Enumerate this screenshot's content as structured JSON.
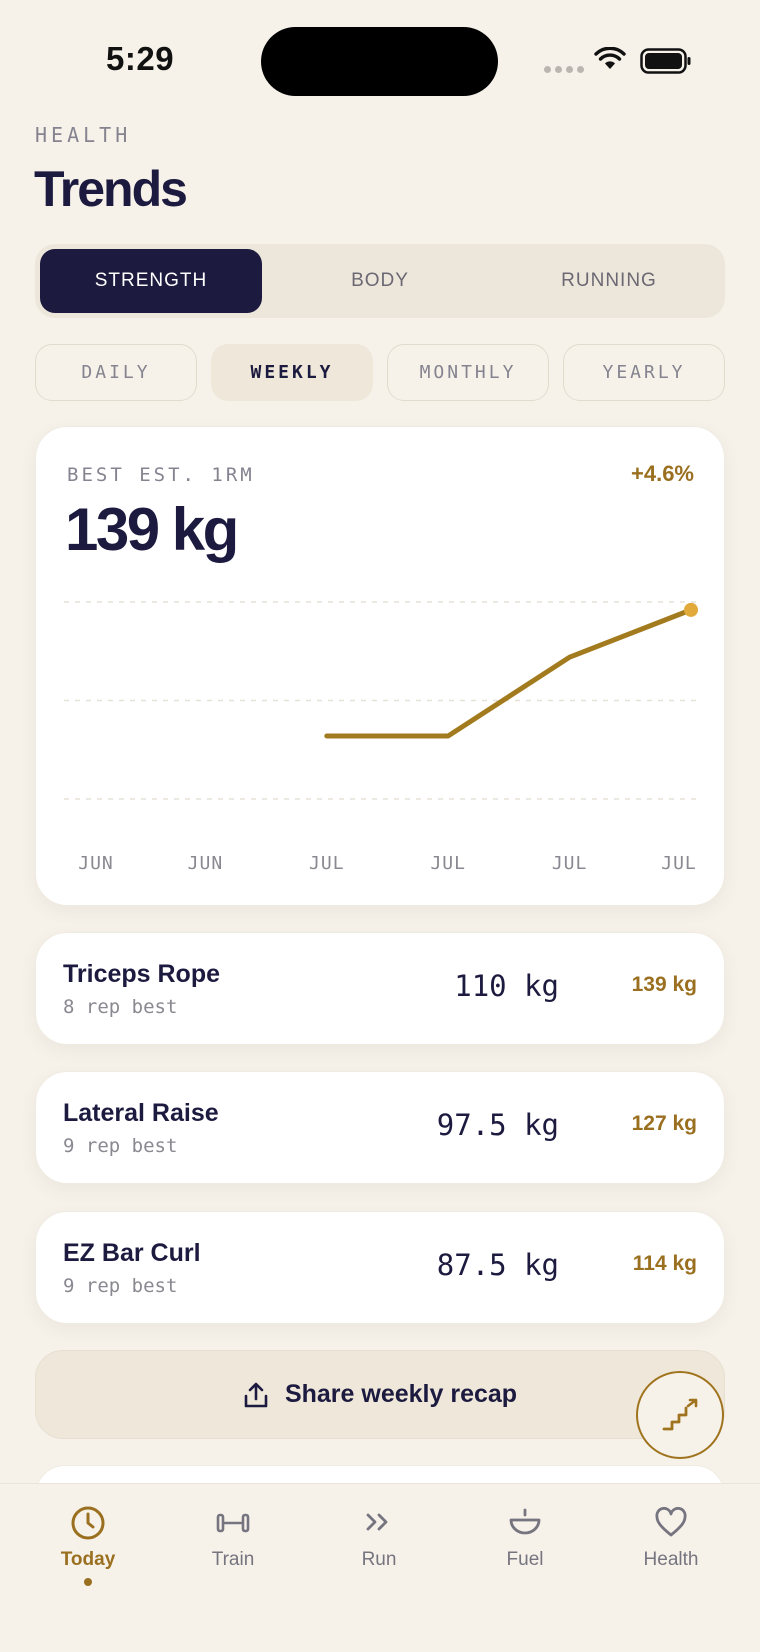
{
  "status_bar": {
    "time": "5:29"
  },
  "header": {
    "eyebrow": "HEALTH",
    "title": "Trends"
  },
  "segments": [
    {
      "label": "STRENGTH",
      "active": true
    },
    {
      "label": "BODY",
      "active": false
    },
    {
      "label": "RUNNING",
      "active": false
    }
  ],
  "periods": [
    {
      "label": "DAILY",
      "active": false
    },
    {
      "label": "WEEKLY",
      "active": true
    },
    {
      "label": "MONTHLY",
      "active": false
    },
    {
      "label": "YEARLY",
      "active": false
    }
  ],
  "metric": {
    "label": "BEST EST. 1RM",
    "value": "139 kg",
    "change": "+4.6%"
  },
  "chart_data": {
    "type": "line",
    "categories": [
      "JUN",
      "JUN",
      "JUL",
      "JUL",
      "JUL",
      "JUL"
    ],
    "series": [
      {
        "values": [
          null,
          null,
          123,
          123,
          133,
          139
        ]
      }
    ],
    "ylim": [
      115,
      140
    ],
    "grid": true,
    "line_color": "#a37b1f",
    "endpoint_color": "#e2a93b"
  },
  "exercises": [
    {
      "name": "Triceps Rope",
      "sub": "8 rep best",
      "best": "110 kg",
      "est_1rm": "139 kg"
    },
    {
      "name": "Lateral Raise",
      "sub": "9 rep best",
      "best": "97.5 kg",
      "est_1rm": "127 kg"
    },
    {
      "name": "EZ Bar Curl",
      "sub": "9 rep best",
      "best": "87.5 kg",
      "est_1rm": "114 kg"
    }
  ],
  "share": {
    "label": "Share weekly recap",
    "icon": "share-icon"
  },
  "fab": {
    "icon": "stairs-icon"
  },
  "tabs": [
    {
      "label": "Today",
      "icon": "clock-icon",
      "active": true
    },
    {
      "label": "Train",
      "icon": "dumbbell-icon",
      "active": false
    },
    {
      "label": "Run",
      "icon": "chevrons-right-icon",
      "active": false
    },
    {
      "label": "Fuel",
      "icon": "bowl-icon",
      "active": false
    },
    {
      "label": "Health",
      "icon": "heart-icon",
      "active": false
    }
  ],
  "colors": {
    "background": "#f6f2ea",
    "navy": "#1c1a3f",
    "accent": "#9a7020"
  }
}
